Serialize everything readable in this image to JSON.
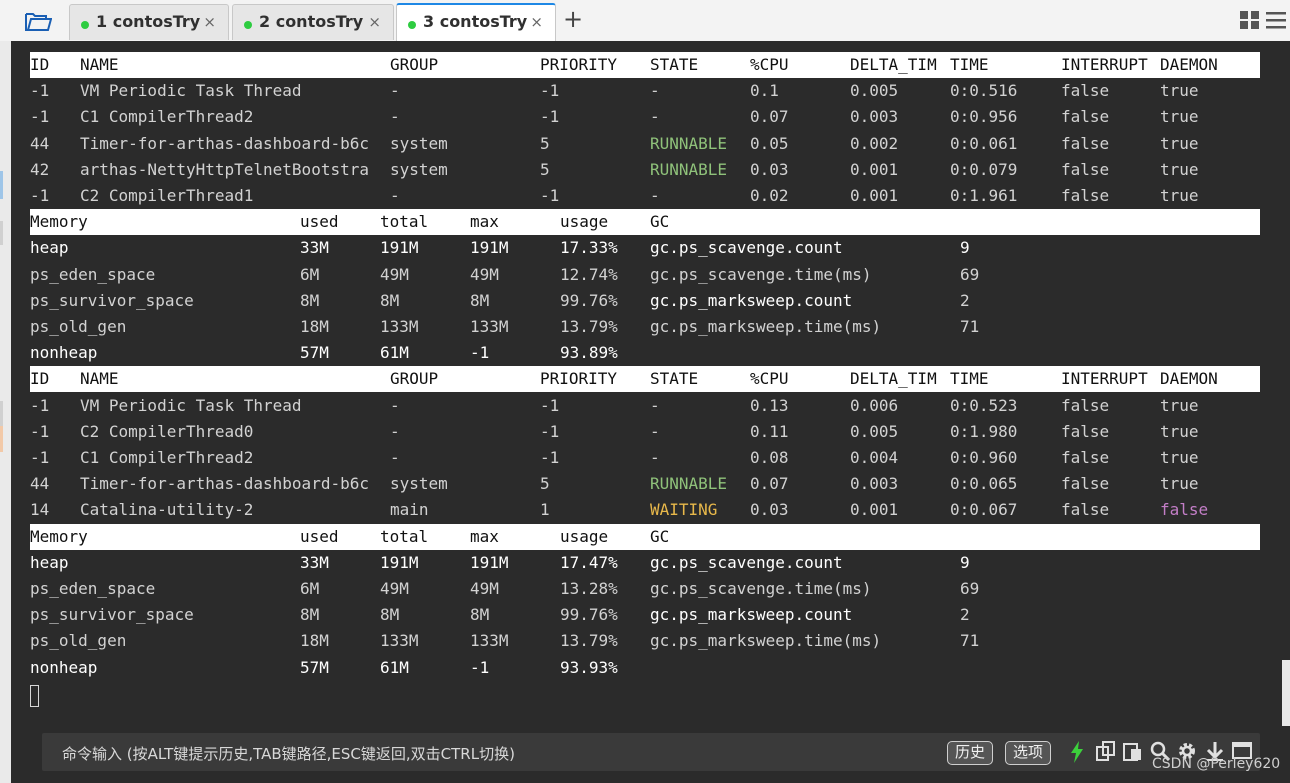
{
  "tabs": [
    {
      "label": "1 contosTry",
      "close": "×"
    },
    {
      "label": "2 contosTry",
      "close": "×"
    },
    {
      "label": "3 contosTry",
      "close": "×",
      "active": true
    }
  ],
  "new_tab": "+",
  "thread_header": [
    "ID",
    "NAME",
    "GROUP",
    "PRIORITY",
    "STATE",
    "%CPU",
    "DELTA_TIM",
    "TIME",
    "INTERRUPT",
    "DAEMON"
  ],
  "thread_blocks": [
    [
      [
        "-1",
        "VM Periodic Task Thread",
        "-",
        "-1",
        "-",
        "0.1",
        "0.005",
        "0:0.516",
        "false",
        "true"
      ],
      [
        "-1",
        "C1 CompilerThread2",
        "-",
        "-1",
        "-",
        "0.07",
        "0.003",
        "0:0.956",
        "false",
        "true"
      ],
      [
        "44",
        "Timer-for-arthas-dashboard-b6c",
        "system",
        "5",
        "RUNNABLE",
        "0.05",
        "0.002",
        "0:0.061",
        "false",
        "true"
      ],
      [
        "42",
        "arthas-NettyHttpTelnetBootstra",
        "system",
        "5",
        "RUNNABLE",
        "0.03",
        "0.001",
        "0:0.079",
        "false",
        "true"
      ],
      [
        "-1",
        "C2 CompilerThread1",
        "-",
        "-1",
        "-",
        "0.02",
        "0.001",
        "0:1.961",
        "false",
        "true"
      ]
    ],
    [
      [
        "-1",
        "VM Periodic Task Thread",
        "-",
        "-1",
        "-",
        "0.13",
        "0.006",
        "0:0.523",
        "false",
        "true"
      ],
      [
        "-1",
        "C2 CompilerThread0",
        "-",
        "-1",
        "-",
        "0.11",
        "0.005",
        "0:1.980",
        "false",
        "true"
      ],
      [
        "-1",
        "C1 CompilerThread2",
        "-",
        "-1",
        "-",
        "0.08",
        "0.004",
        "0:0.960",
        "false",
        "true"
      ],
      [
        "44",
        "Timer-for-arthas-dashboard-b6c",
        "system",
        "5",
        "RUNNABLE",
        "0.07",
        "0.003",
        "0:0.065",
        "false",
        "true"
      ],
      [
        "14",
        "Catalina-utility-2",
        "main",
        "1",
        "WAITING",
        "0.03",
        "0.001",
        "0:0.067",
        "false",
        "false"
      ]
    ]
  ],
  "memory_header": [
    "Memory",
    "used",
    "total",
    "max",
    "usage",
    "GC"
  ],
  "memory_blocks": [
    [
      [
        "heap",
        "33M",
        "191M",
        "191M",
        "17.33%",
        "gc.ps_scavenge.count",
        "9"
      ],
      [
        "ps_eden_space",
        "6M",
        "49M",
        "49M",
        "12.74%",
        "gc.ps_scavenge.time(ms)",
        "69"
      ],
      [
        "ps_survivor_space",
        "8M",
        "8M",
        "8M",
        "99.76%",
        "gc.ps_marksweep.count",
        "2"
      ],
      [
        "ps_old_gen",
        "18M",
        "133M",
        "133M",
        "13.79%",
        "gc.ps_marksweep.time(ms)",
        "71"
      ],
      [
        "nonheap",
        "57M",
        "61M",
        "-1",
        "93.89%",
        "",
        ""
      ]
    ],
    [
      [
        "heap",
        "33M",
        "191M",
        "191M",
        "17.47%",
        "gc.ps_scavenge.count",
        "9"
      ],
      [
        "ps_eden_space",
        "6M",
        "49M",
        "49M",
        "13.28%",
        "gc.ps_scavenge.time(ms)",
        "69"
      ],
      [
        "ps_survivor_space",
        "8M",
        "8M",
        "8M",
        "99.76%",
        "gc.ps_marksweep.count",
        "2"
      ],
      [
        "ps_old_gen",
        "18M",
        "133M",
        "133M",
        "13.79%",
        "gc.ps_marksweep.time(ms)",
        "71"
      ],
      [
        "nonheap",
        "57M",
        "61M",
        "-1",
        "93.93%",
        "",
        ""
      ]
    ]
  ],
  "command_bar": {
    "hint": "命令输入 (按ALT键提示历史,TAB键路径,ESC键返回,双击CTRL切换)",
    "history_label": "历史",
    "options_label": "选项"
  },
  "icons": [
    "folder-icon",
    "layout-icon",
    "menu-icon",
    "lightning-icon",
    "copy-icon",
    "paste-icon",
    "search-icon",
    "gear-icon",
    "download-icon",
    "window-icon"
  ],
  "colors": {
    "runnable": "#8fc27a",
    "waiting": "#e8b84a",
    "daemon_false": "#c37ec7",
    "tab_dot": "#2ecc40",
    "active_tab": "#1e88e5"
  },
  "watermark": "CSDN @Perley620"
}
